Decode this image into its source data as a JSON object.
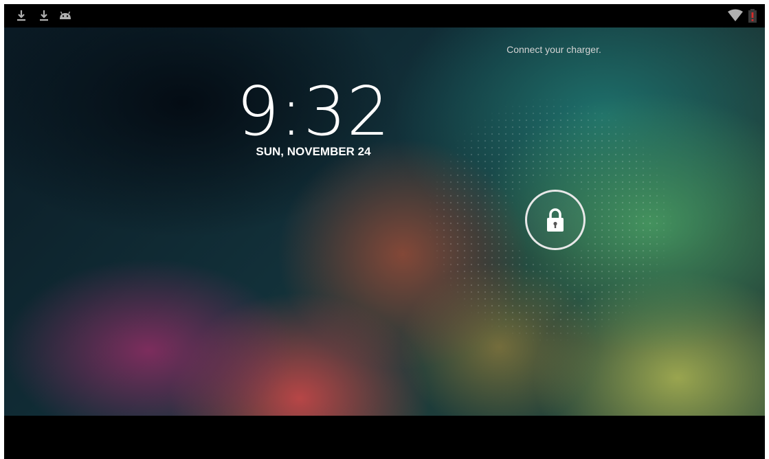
{
  "status_bar": {
    "left_icons": [
      "download-icon",
      "download-icon",
      "android-icon"
    ],
    "right_icons": [
      "wifi-icon",
      "battery-low-icon"
    ],
    "battery_color": "#d62b2b"
  },
  "lockscreen": {
    "charger_message": "Connect your charger.",
    "time": "9:32",
    "date": "SUN, NOVEMBER 24",
    "unlock_icon": "lock-icon"
  }
}
